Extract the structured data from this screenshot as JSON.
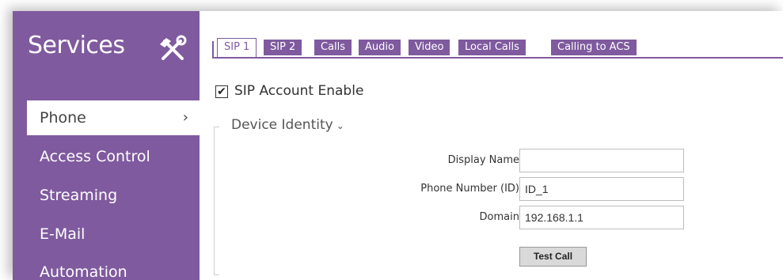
{
  "sidebar": {
    "title": "Services",
    "icon": "tools-icon",
    "items": [
      {
        "label": "Phone",
        "active": true,
        "chevron": "›"
      },
      {
        "label": "Access Control"
      },
      {
        "label": "Streaming"
      },
      {
        "label": "E-Mail"
      },
      {
        "label": "Automation"
      }
    ]
  },
  "tabs": [
    {
      "label": "SIP 1",
      "active": true
    },
    {
      "label": "SIP 2"
    },
    {
      "label": "Calls"
    },
    {
      "label": "Audio"
    },
    {
      "label": "Video"
    },
    {
      "label": "Local Calls"
    },
    {
      "label": "Calling to ACS"
    }
  ],
  "sip_enable": {
    "label": "SIP Account Enable",
    "checked": true,
    "check_mark": "✔"
  },
  "device_identity": {
    "title": "Device Identity",
    "caret": "⌄",
    "fields": {
      "display_name": {
        "label": "Display Name",
        "value": ""
      },
      "phone_number": {
        "label": "Phone Number (ID)",
        "value": "ID_1"
      },
      "domain": {
        "label": "Domain",
        "value": "192.168.1.1"
      }
    },
    "test_call_label": "Test Call"
  },
  "colors": {
    "accent": "#7f5a9e",
    "sidebar_text": "#ffffff"
  }
}
